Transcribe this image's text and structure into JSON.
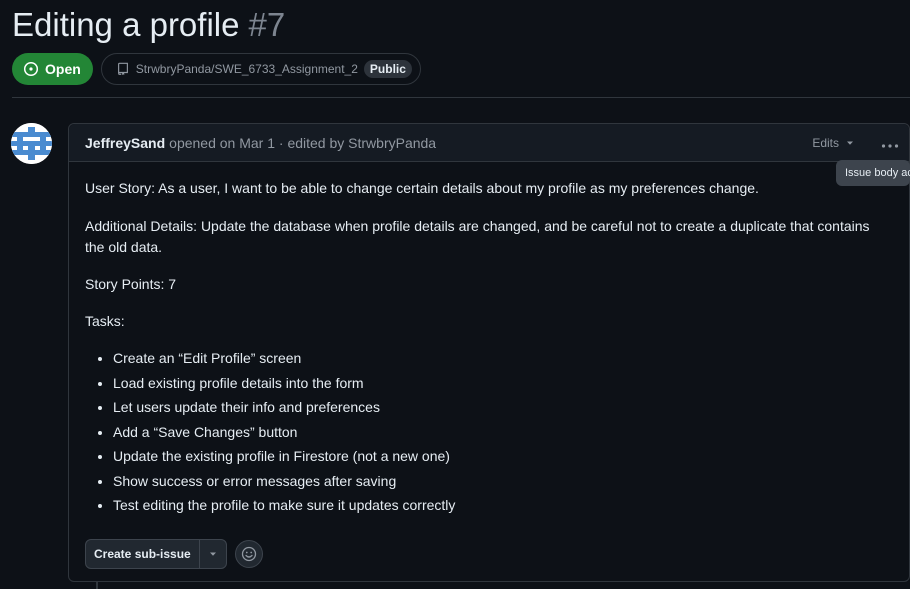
{
  "issue": {
    "title": "Editing a profile",
    "number": "#7",
    "state": "Open",
    "repo": "StrwbryPanda/SWE_6733_Assignment_2",
    "visibility": "Public"
  },
  "comment": {
    "author": "JeffreySand",
    "meta": "opened on Mar 1 · edited by StrwbryPanda",
    "edits_label": "Edits",
    "tooltip": "Issue body ac",
    "story": "User Story: As a user, I want to be able to change certain details about my profile as my preferences change.",
    "details": "Additional Details: Update the database when profile details are changed, and be careful not to create a duplicate that contains the old data.",
    "points": "Story Points: 7",
    "tasks_heading": "Tasks:",
    "tasks": [
      "Create an “Edit Profile” screen",
      "Load existing profile details into the form",
      "Let users update their info and preferences",
      "Add a “Save Changes” button",
      "Update the existing profile in Firestore (not a new one)",
      "Show success or error messages after saving",
      "Test editing the profile to make sure it updates correctly"
    ],
    "sub_issue_button": "Create sub-issue"
  },
  "colors": {
    "background": "#0d1117",
    "open_green": "#238636",
    "border": "#30363d",
    "muted_text": "#9198a1"
  },
  "icons": [
    "issue-opened-icon",
    "repo-icon",
    "triangle-down-icon",
    "kebab-horizontal-icon",
    "smiley-icon"
  ]
}
